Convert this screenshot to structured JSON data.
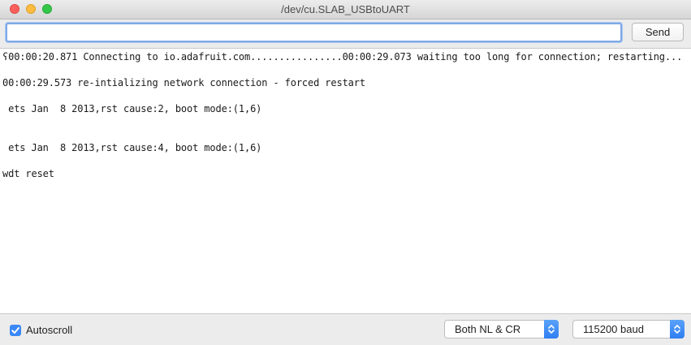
{
  "window": {
    "title": "/dev/cu.SLAB_USBtoUART"
  },
  "toolbar": {
    "input_value": "",
    "send_label": "Send"
  },
  "console": {
    "lines": [
      "ʕ00:00:20.871 Connecting to io.adafruit.com................00:00:29.073 waiting too long for connection; restarting...",
      "00:00:29.573 re-intializing network connection - forced restart",
      " ets Jan  8 2013,rst cause:2, boot mode:(1,6)",
      " ets Jan  8 2013,rst cause:4, boot mode:(1,6)",
      "wdt reset"
    ]
  },
  "statusbar": {
    "autoscroll_label": "Autoscroll",
    "autoscroll_checked": true,
    "line_ending": "Both NL & CR",
    "baud": "115200 baud"
  },
  "icons": {
    "checkbox": "checkmark-icon",
    "select_arrows": "up-down-arrows-icon"
  },
  "colors": {
    "accent": "#3b88f5",
    "close": "#fc605c",
    "minimize": "#fdbc40",
    "maximize": "#34c84a"
  }
}
